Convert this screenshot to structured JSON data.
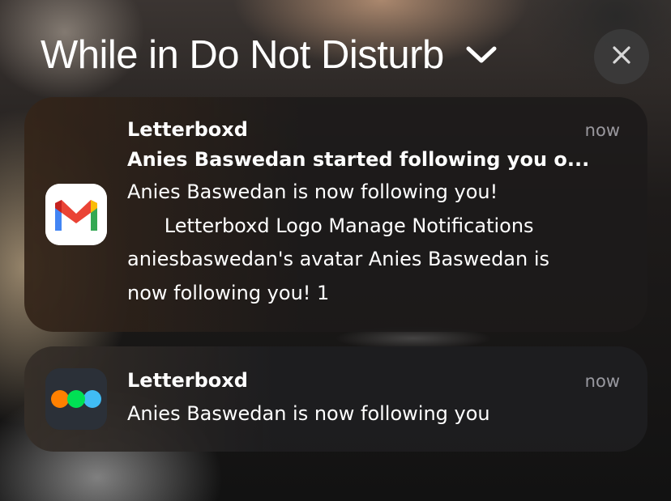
{
  "header": {
    "title": "While in Do Not Disturb"
  },
  "notifications": [
    {
      "app": "Letterboxd",
      "time": "now",
      "icon": "gmail-icon",
      "subject": "Anies Baswedan started following you o...",
      "message": "Anies Baswedan is now following you!\n      Letterboxd Logo Manage Notifications\naniesbaswedan's avatar Anies Baswedan is\nnow following you! 1"
    },
    {
      "app": "Letterboxd",
      "time": "now",
      "icon": "letterboxd-icon",
      "message": "Anies Baswedan is now following you"
    }
  ],
  "colors": {
    "gmail_red": "#EA4335",
    "gmail_blue": "#4285F4",
    "gmail_green": "#34A853",
    "gmail_yellow": "#FBBC04",
    "letterboxd_orange": "#FF8000",
    "letterboxd_green": "#00E054",
    "letterboxd_blue": "#40BCF4"
  }
}
